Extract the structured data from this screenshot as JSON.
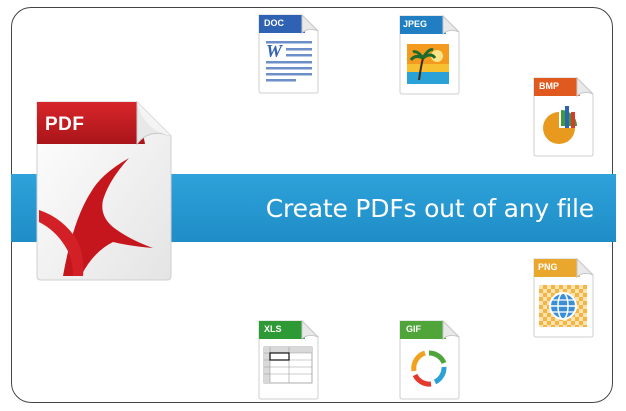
{
  "banner": {
    "text": "Create PDFs out of any file",
    "color": "#2399d3"
  },
  "main_icon": {
    "label": "PDF",
    "color": "#c01c20"
  },
  "file_icons": [
    {
      "label": "DOC",
      "color": "#2f62b3",
      "icon": "word-document-icon"
    },
    {
      "label": "JPEG",
      "color": "#1f7fc2",
      "icon": "beach-image-icon"
    },
    {
      "label": "BMP",
      "color": "#e05a1f",
      "icon": "pie-chart-icon"
    },
    {
      "label": "PNG",
      "color": "#e9a72d",
      "icon": "globe-checker-icon"
    },
    {
      "label": "XLS",
      "color": "#2e9a36",
      "icon": "spreadsheet-icon"
    },
    {
      "label": "GIF",
      "color": "#4fa43a",
      "icon": "color-ring-icon"
    }
  ]
}
